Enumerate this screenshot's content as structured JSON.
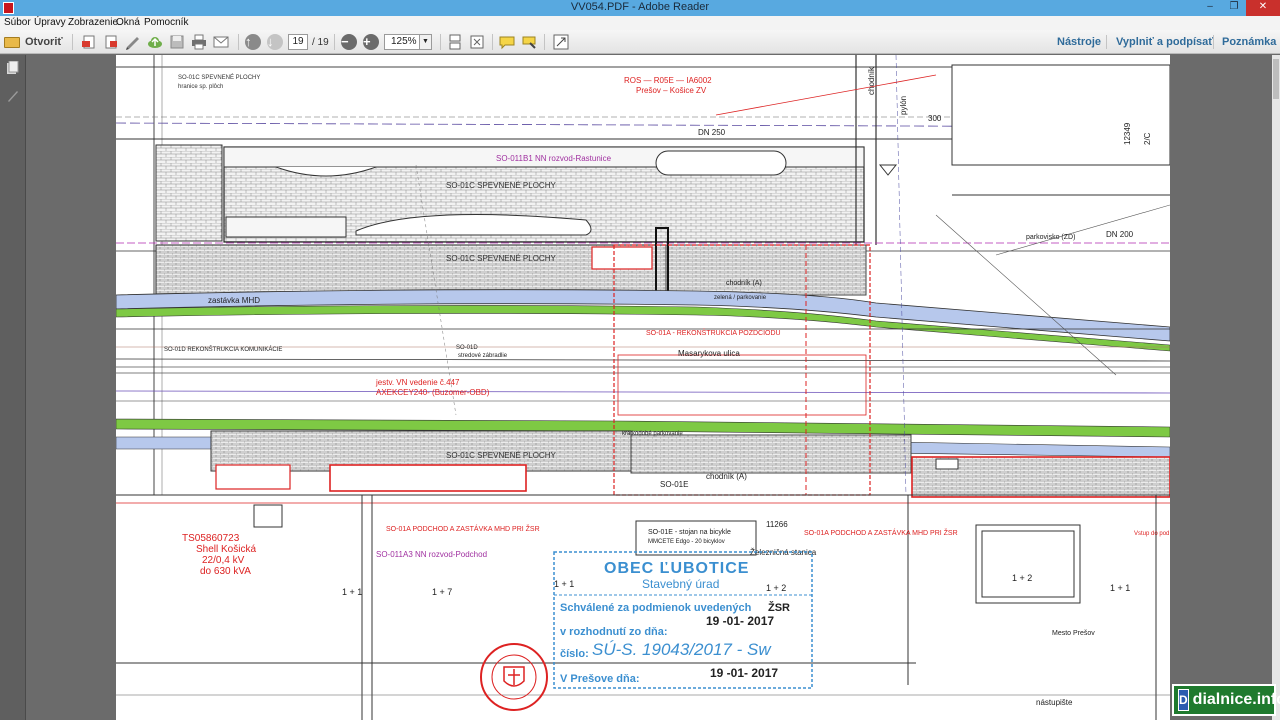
{
  "window": {
    "title": "VV054.PDF - Adobe Reader",
    "minimize": "–",
    "restore": "❐",
    "close": "✕"
  },
  "menu": [
    "Súbor",
    "Úpravy",
    "Zobrazenie",
    "Okná",
    "Pomocník"
  ],
  "toolbar": {
    "open_label": "Otvoriť",
    "page_current": "19",
    "page_total": "/ 19",
    "zoom": "125%",
    "right_links": [
      "Nástroje",
      "Vyplniť a podpísať",
      "Poznámka"
    ]
  },
  "drawing": {
    "top_labels": {
      "so01c_top": "SO-01C SPEVNENÉ PLOCHY",
      "hranice": "hranice sp. plôch",
      "dn": "DN 250",
      "ros": "ROS — R05E — IA6002",
      "presov_kosice": "Prešov – Košice ZV",
      "so011b": "SO-011B1 NN rozvod-Rastunice",
      "so01c_mid": "SO-01C SPEVNENÉ PLOCHY",
      "chodnik": "chodník",
      "pylon": "pylón",
      "num_12349": "12349",
      "num_2c": "2/C",
      "num_300": "300",
      "parkovisko": "parkovisko (ZD)",
      "dn200": "DN 200",
      "so01c_lower": "SO-01C SPEVNENÉ PLOCHY",
      "zastavka": "zastávka MHD",
      "chodnik_a": "chodník (A)",
      "zelen": "zelená / parkovanie",
      "so01d": "SO-01D REKONŠTRUKCIA KOMUNIKÁCIE",
      "so01d_short": "SO-01D",
      "stredove": "stredové zábradlie",
      "so01a_rek": "SO-01A - REKONŠTRUKCIA POZDCIODU",
      "masarykova": "Masarykova ulica",
      "jestv": "jestv. VN vedenie č.447",
      "axekcey": "AXEKCEY240- (Buzomer-OBD)",
      "kratkodobe": "krátkodobé parkovanie",
      "so01c_bottom": "SO-01C SPEVNENÉ PLOCHY",
      "so01e": "SO-01E",
      "chodnik_a2": "chodník (A)",
      "so01a_podchod": "SO-01A PODCHOD A ZASTÁVKA MHD PRI ŽSR",
      "so01e_stojan": "SO-01E - stojan na bicykle",
      "mmcete": "MMCETE Edgo - 20 bicyklov",
      "num_11266": "11266",
      "so01a_podchod2": "SO-01A PODCHOD A ZASTÁVKA MHD PRI ŽSR",
      "so011a3": "SO-011A3 NN rozvod-Podchod",
      "tso": "TS05860723",
      "shell": "Shell Košická",
      "kv": "22/0,4 kV",
      "kva": "do 630 kVA",
      "zeleznicna": "Železničná stanica",
      "mesto": "Mesto Prešov",
      "nastupiste": "nástupište",
      "votup": "Vstup do pod",
      "p11": "1 + 1",
      "p17": "1 + 7",
      "p12": "1 + 2",
      "p11b": "1 + 1",
      "p12b": "1 + 2",
      "p11c": "1 + 1"
    },
    "stamp": {
      "org": "OBEC ĽUBOTICE",
      "dept": "Stavebný úrad",
      "approved": "Schválené za podmienok uvedených",
      "zsr": "ŽSR",
      "decision": "v rozhodnutí zo dňa:",
      "date1": "19 -01- 2017",
      "number_label": "číslo:",
      "number_value": "SÚ-S. 19043/2017 - Sw",
      "city": "V Prešove dňa:",
      "date2": "19 -01- 2017"
    }
  },
  "watermark": {
    "text": "dialnice.info",
    "icon": "D"
  }
}
